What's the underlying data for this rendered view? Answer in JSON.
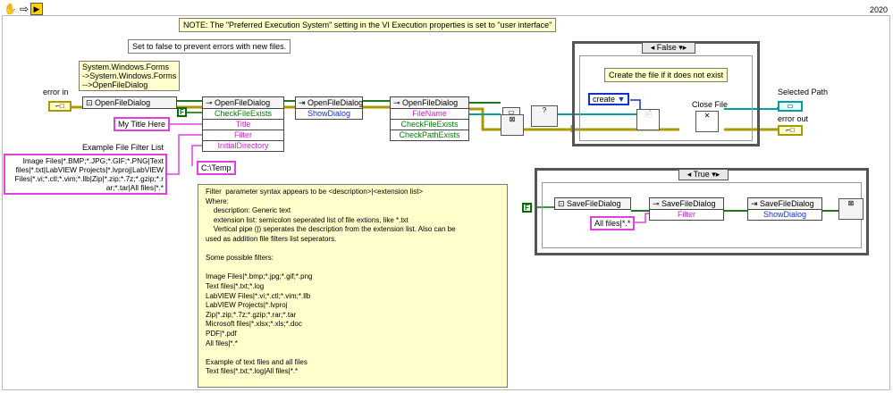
{
  "toolbar": {
    "icons": [
      "hand-icon",
      "arrow-icon",
      "run-icon"
    ],
    "version": "2020"
  },
  "notes": {
    "execution_note": "NOTE: The \"Preferred Execution System\" setting in the  VI Execution properties is set to \"user interface\"",
    "set_false_note": "Set to false to prevent errors with new files.",
    "class_note": [
      "System.Windows.Forms",
      "->System.Windows.Forms",
      "-->OpenFileDialog"
    ],
    "filter_list_label": "Example File Filter List",
    "filter_list_text": [
      "Image Files|*.BMP;*.JPG;*.GIF;*.PNG|Text",
      "files|*.txt|LabVIEW Projects|*.lvproj|LabVIEW",
      "Files|*.vi;*.ctl;*.vim;*.llb|Zip|*.zip;*.7z;*.gzip;*.r",
      "ar;*.tar|All files|*.*"
    ]
  },
  "labels": {
    "error_in": "error in",
    "selected_path": "Selected Path",
    "error_out": "error out",
    "close_file": "Close File",
    "create_file_note": "Create the file if it does not exist"
  },
  "constants": {
    "title": "My Title Here",
    "initial_dir": "C:\\Temp",
    "all_files": "All files|*.*",
    "create": "create",
    "bool_false": "F"
  },
  "nodes": {
    "ctor": "OpenFileDialog",
    "prop1": {
      "title": "OpenFileDialog",
      "props": [
        "CheckFileExists",
        "Title",
        "Filter",
        "InitialDirectory"
      ]
    },
    "invoke1": {
      "title": "OpenFileDialog",
      "props": [
        "ShowDialog"
      ]
    },
    "prop2": {
      "title": "OpenFileDialog",
      "props": [
        "FileName",
        "CheckFileExists",
        "CheckPathExists"
      ]
    },
    "save_ctor": "SaveFileDialog",
    "save_prop": {
      "title": "SaveFileDialog",
      "props": [
        "Filter"
      ]
    },
    "save_invoke": {
      "title": "SaveFileDialog",
      "props": [
        "ShowDialog"
      ]
    }
  },
  "cases": {
    "false_case": "False",
    "true_case": "True"
  },
  "comment": {
    "lines": [
      "Filter  parameter syntax appears to be <description>|<extension list>",
      "Where:",
      "    description: Generic text",
      "    extension list: semicolon seperated list of file extions, like *.txt",
      "    Vertical pipe (|) seperates the description from the extension list. Also can be",
      "used as addition file filters list seperators.",
      "",
      "Some possible filters:",
      "",
      "Image Files|*.bmp;*.jpg;*.gif;*.png",
      "Text files|*.txt;*.log",
      "LabVIEW Files|*.vi;*.ctl;*.vim;*.llb",
      "LabVIEW Projects|*.lvproj",
      "Zip|*.zip;*.7z;*.gzip;*.rar;*.tar",
      "Microsoft files|*.xlsx;*.xls;*.doc",
      "PDF|*.pdf",
      "All files|*.*",
      "",
      "Example of text files and all files",
      "Text files|*.txt;*.log|All files|*.*"
    ]
  },
  "colors": {
    "error_wire": "#a89a00",
    "ref_wire": "#1e7a1e",
    "string_wire": "#e040e0",
    "path_wire": "#00a0a0",
    "bool_wire": "#006e00",
    "enum_wire": "#1030d0"
  }
}
